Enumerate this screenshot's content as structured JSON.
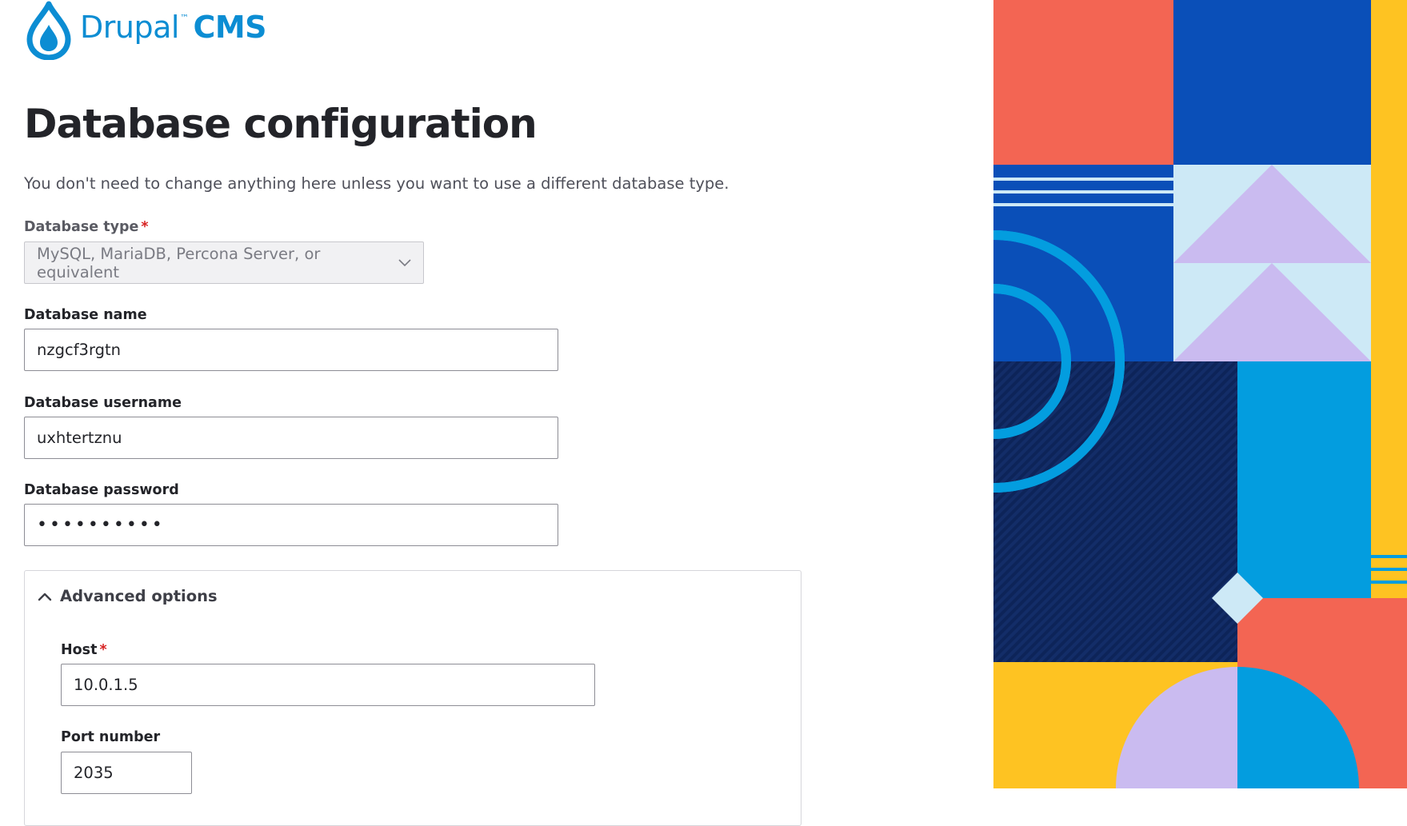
{
  "brand": {
    "name": "Drupal",
    "trademark": "™",
    "product": "CMS",
    "color": "#0c8dd3"
  },
  "page": {
    "title": "Database configuration",
    "intro": "You don't need to change anything here unless you want to use a different database type."
  },
  "form": {
    "db_type": {
      "label": "Database type",
      "required_mark": "*",
      "value": "MySQL, MariaDB, Percona Server, or equivalent"
    },
    "db_name": {
      "label": "Database name",
      "value": "nzgcf3rgtn"
    },
    "db_username": {
      "label": "Database username",
      "value": "uxhtertznu"
    },
    "db_password": {
      "label": "Database password",
      "masked_value": "••••••••••"
    },
    "advanced": {
      "summary": "Advanced options",
      "expanded": true,
      "host": {
        "label": "Host",
        "required_mark": "*",
        "value": "10.0.1.5"
      },
      "port": {
        "label": "Port number",
        "value": "2035"
      }
    }
  },
  "colors": {
    "accent": "#0c8dd3",
    "required": "#d72222",
    "art_coral": "#f36553",
    "art_blue": "#0a4fb8",
    "art_navy": "#0d2459",
    "art_cyan": "#039ddf",
    "art_lightblue": "#cde9f6",
    "art_lavender": "#cabbf0",
    "art_yellow": "#fec322"
  }
}
